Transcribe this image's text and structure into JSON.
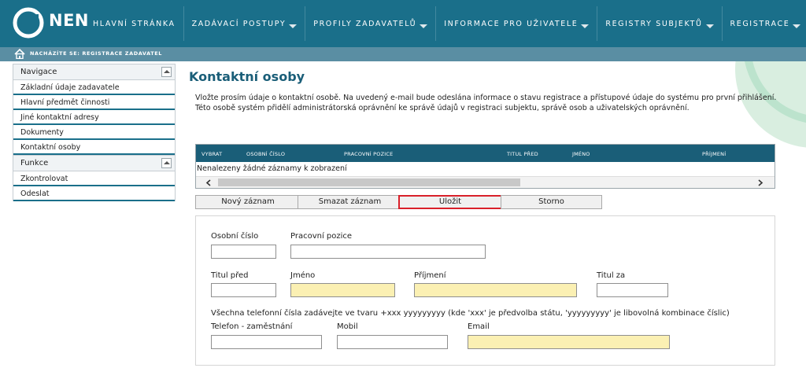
{
  "brand": {
    "name": "NEN"
  },
  "nav": {
    "items": [
      {
        "label": "HLAVNÍ STRÁNKA",
        "dropdown": false
      },
      {
        "label": "ZADÁVACÍ POSTUPY",
        "dropdown": true
      },
      {
        "label": "PROFILY ZADAVATELŮ",
        "dropdown": true
      },
      {
        "label": "INFORMACE PRO UŽIVATELE",
        "dropdown": true
      },
      {
        "label": "REGISTRY SUBJEKTŮ",
        "dropdown": true
      },
      {
        "label": "REGISTRACE",
        "dropdown": true
      }
    ]
  },
  "breadcrumb": {
    "text": "NACHÁZÍTE SE: REGISTRACE ZADAVATEL"
  },
  "sidebar": {
    "nav_title": "Navigace",
    "nav_items": [
      {
        "label": "Základní údaje zadavatele"
      },
      {
        "label": "Hlavní předmět činnosti"
      },
      {
        "label": "Jiné kontaktní adresy"
      },
      {
        "label": "Dokumenty"
      },
      {
        "label": "Kontaktní osoby"
      }
    ],
    "func_title": "Funkce",
    "func_items": [
      {
        "label": "Zkontrolovat"
      },
      {
        "label": "Odeslat"
      }
    ]
  },
  "main": {
    "title": "Kontaktní osoby",
    "intro_line1": "Vložte prosím údaje o kontaktní osobě. Na uvedený e-mail bude odeslána informace o stavu registrace a přístupové údaje do systému pro první přihlášení.",
    "intro_line2": "Této osobě systém přidělí administrátorská oprávnění ke správě údajů v registraci subjektu, správě osob a uživatelských oprávnění."
  },
  "table": {
    "columns": [
      "VYBRAT",
      "OSOBNÍ ČÍSLO",
      "PRACOVNÍ POZICE",
      "TITUL PŘED",
      "JMÉNO",
      "PŘÍJMENÍ"
    ],
    "empty_text": "Nenalezeny žádné záznamy k zobrazení"
  },
  "buttons": {
    "new": "Nový záznam",
    "delete": "Smazat záznam",
    "save": "Uložit",
    "cancel": "Storno"
  },
  "form": {
    "personal_number": {
      "label": "Osobní číslo",
      "value": ""
    },
    "position": {
      "label": "Pracovní pozice",
      "value": ""
    },
    "title_before": {
      "label": "Titul před",
      "value": ""
    },
    "first_name": {
      "label": "Jméno",
      "value": ""
    },
    "last_name": {
      "label": "Příjmení",
      "value": ""
    },
    "title_after": {
      "label": "Titul za",
      "value": ""
    },
    "phone_hint": "Všechna telefonní čísla zadávejte ve tvaru +xxx yyyyyyyyy (kde 'xxx' je předvolba státu, 'yyyyyyyyy' je libovolná kombinace číslic)",
    "work_phone": {
      "label": "Telefon - zaměstnání",
      "value": ""
    },
    "mobile": {
      "label": "Mobil",
      "value": ""
    },
    "email": {
      "label": "Email",
      "value": ""
    }
  },
  "colors": {
    "header": "#1a6f8a",
    "breadcrumb_bar": "#5a8ea3",
    "table_header": "#1a5e78",
    "required_field": "#fbf0b3",
    "highlight": "#d9202a"
  }
}
